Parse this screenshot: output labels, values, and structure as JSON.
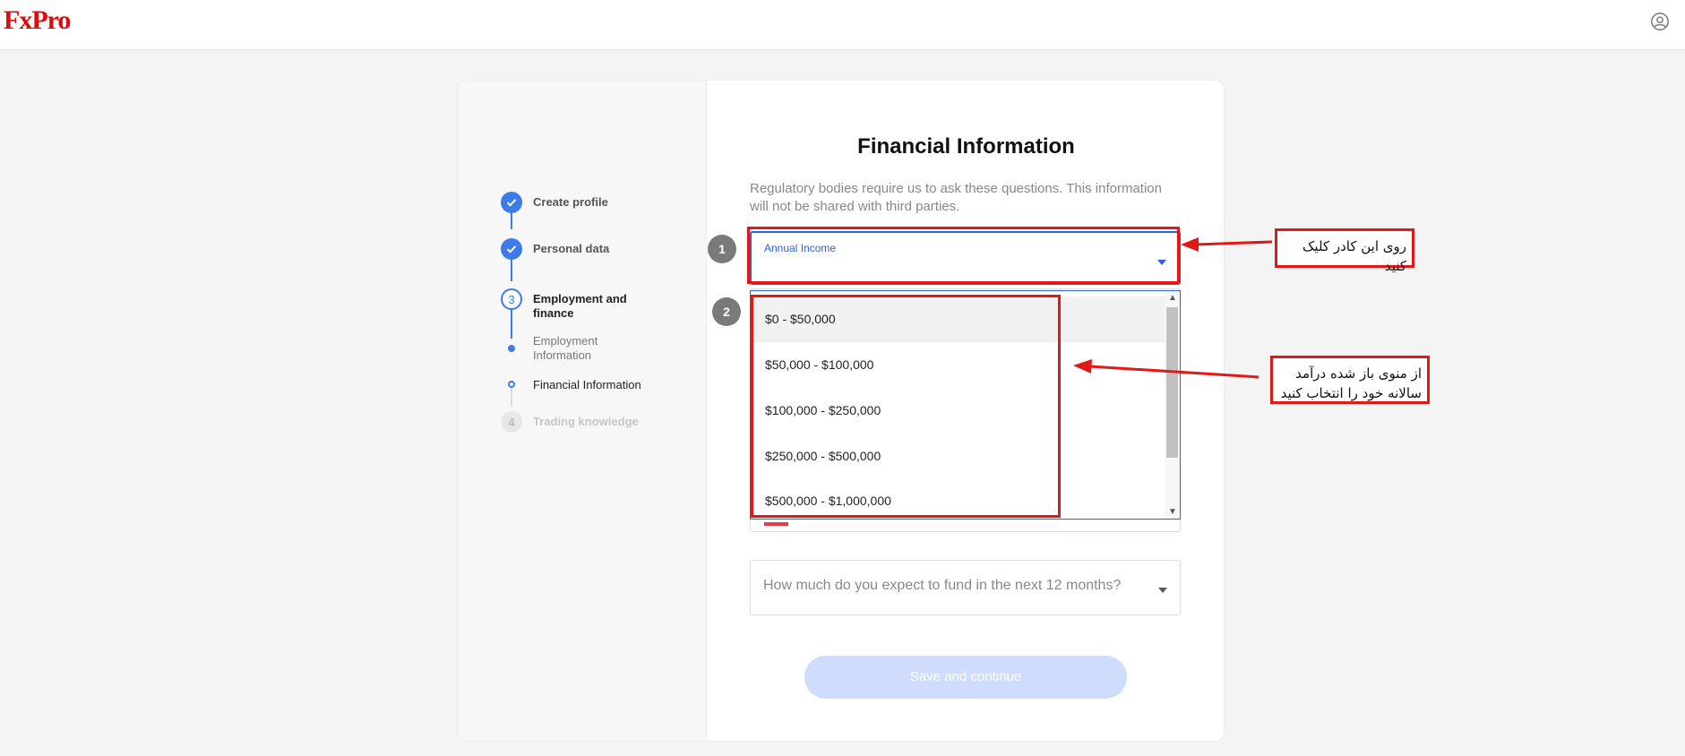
{
  "brand": {
    "logo_text": "FxPro",
    "accent": "#e10a0a"
  },
  "header": {
    "user_icon": "user-circle-icon"
  },
  "stepper": {
    "steps": [
      {
        "number": "",
        "label": "Create profile",
        "state": "done"
      },
      {
        "number": "",
        "label": "Personal data",
        "state": "done"
      },
      {
        "number": "3",
        "label": "Employment and finance",
        "state": "active"
      },
      {
        "number": "4",
        "label": "Trading knowledge",
        "state": "future"
      }
    ],
    "substeps": [
      {
        "label": "Employment Information",
        "state": "done"
      },
      {
        "label": "Financial Information",
        "state": "current"
      }
    ]
  },
  "form": {
    "title": "Financial Information",
    "description": "Regulatory bodies require us to ask these questions. This information will not be shared with third parties.",
    "income_field": {
      "label": "Annual Income",
      "value": ""
    },
    "income_options": [
      "$0 - $50,000",
      "$50,000 - $100,000",
      "$100,000 - $250,000",
      "$250,000 - $500,000",
      "$500,000 - $1,000,000"
    ],
    "fund_field": {
      "placeholder": "How much do you expect to fund in the next 12 months?"
    },
    "save_button": "Save and continue"
  },
  "annotations": {
    "badge_1": "1",
    "badge_2": "2",
    "note_1": "روی این کادر کلیک کنید",
    "note_2": "از منوی باز شده درآمد سالانه خود را انتخاب کنید"
  },
  "colors": {
    "primary": "#3f7be8",
    "focus": "#2a62e3",
    "annotation_red": "#e01818",
    "button_disabled": "#cfdcfb"
  }
}
